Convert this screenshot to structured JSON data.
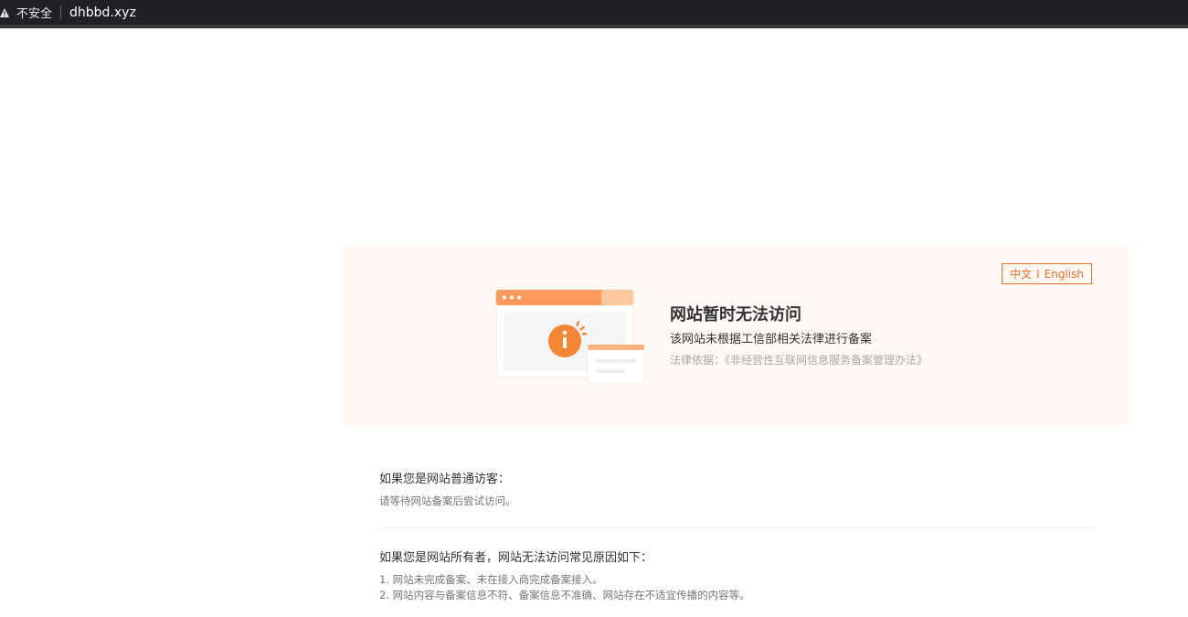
{
  "browser": {
    "insecure_label": "不安全",
    "url": "dhbbd.xyz",
    "icons": {
      "warning": "warning-triangle-icon"
    }
  },
  "notice": {
    "lang_zh": "中文",
    "lang_sep": "I",
    "lang_en": "English",
    "title": "网站暂时无法访问",
    "subtitle": "该网站未根据工信部相关法律进行备案",
    "legal_basis": "法律依据：《非经营性互联网信息服务备案管理办法》",
    "accent_color": "#f06f25"
  },
  "visitor": {
    "title": "如果您是网站普通访客：",
    "text": "请等待网站备案后尝试访问。"
  },
  "owner": {
    "title": "如果您是网站所有者，网站无法访问常见原因如下：",
    "reasons": [
      "1. 网站未完成备案、未在接入商完成备案接入。",
      "2. 网站内容与备案信息不符、备案信息不准确、网站存在不适宜传播的内容等。"
    ]
  }
}
